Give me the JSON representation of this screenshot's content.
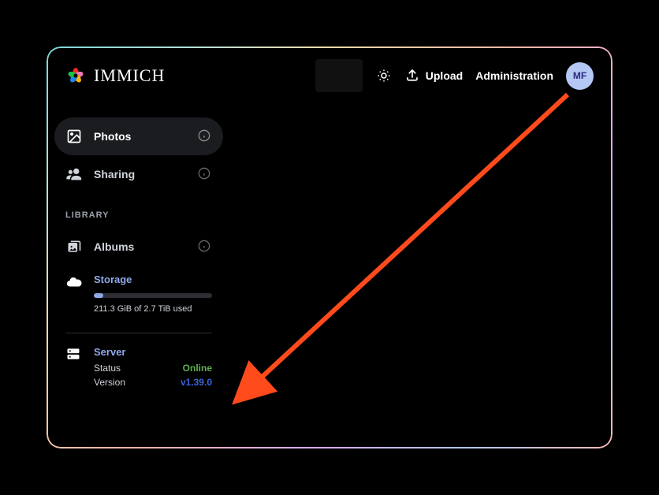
{
  "brand": "IMMICH",
  "header": {
    "upload_label": "Upload",
    "admin_label": "Administration",
    "avatar_initials": "MF"
  },
  "sidebar": {
    "nav": [
      {
        "label": "Photos"
      },
      {
        "label": "Sharing"
      }
    ],
    "library_header": "LIBRARY",
    "albums_label": "Albums",
    "storage": {
      "title": "Storage",
      "used_text": "211.3 GiB of 2.7 TiB used",
      "percent": 8
    },
    "server": {
      "title": "Server",
      "status_label": "Status",
      "status_value": "Online",
      "version_label": "Version",
      "version_value": "v1.39.0"
    }
  }
}
